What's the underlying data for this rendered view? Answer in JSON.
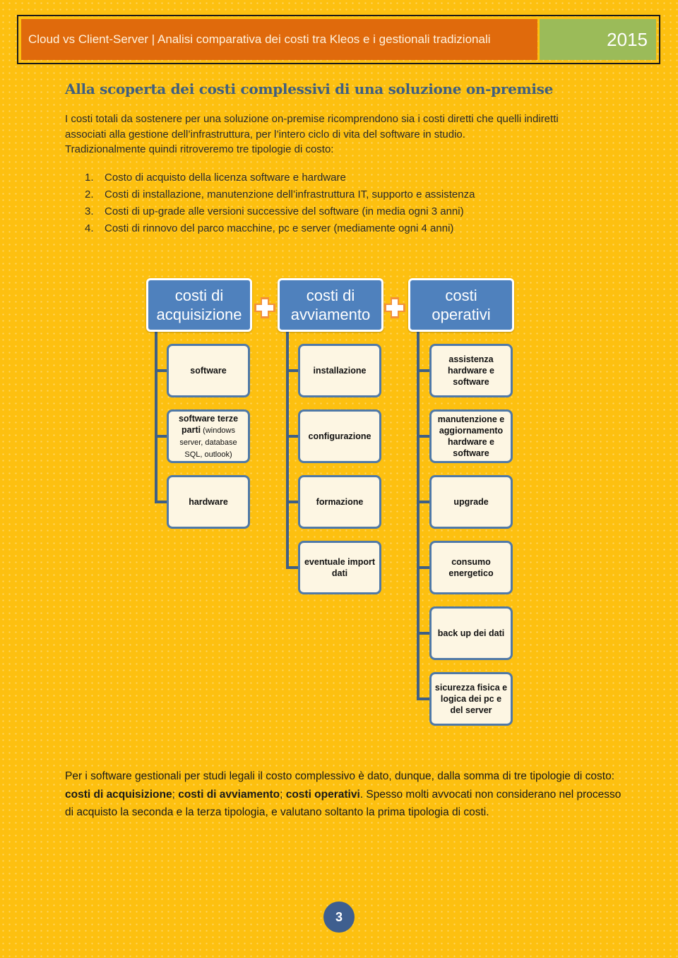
{
  "header": {
    "title": "Cloud vs Client-Server | Analisi comparativa dei costi tra Kleos e i gestionali tradizionali",
    "year": "2015",
    "colors": {
      "title_bg": "#E06A0C",
      "year_bg": "#9BBB59",
      "page_bg": "#FDC010"
    }
  },
  "section": {
    "title": "Alla scoperta dei costi complessivi di una soluzione on-premise",
    "intro": [
      "I costi totali da sostenere per una soluzione on-premise ricomprendono sia i costi diretti che quelli indiretti",
      "associati alla gestione dell’infrastruttura, per l’intero ciclo di vita del software in studio.",
      "Tradizionalmente quindi ritroveremo tre tipologie di costo:"
    ],
    "list": [
      {
        "num": "1.",
        "text": "Costo di acquisto della licenza software e hardware"
      },
      {
        "num": "2.",
        "text": "Costi di installazione, manutenzione dell’infrastruttura IT, supporto e assistenza"
      },
      {
        "num": "3.",
        "text": "Costi di up-grade alle versioni successive del software (in media ogni 3 anni)"
      },
      {
        "num": "4.",
        "text": "Costi di rinnovo del parco macchine, pc e server (mediamente ogni 4 anni)"
      }
    ]
  },
  "diagram": {
    "operator_icon": "plus-icon",
    "categories": [
      {
        "line1": "costi di",
        "line2": "acquisizione",
        "items": [
          {
            "bold": "software",
            "normal": ""
          },
          {
            "bold": "software  terze parti",
            "normal": " (windows server, database SQL, outlook)"
          },
          {
            "bold": "hardware",
            "normal": ""
          }
        ]
      },
      {
        "line1": "costi di",
        "line2": "avviamento",
        "items": [
          {
            "bold": "installazione",
            "normal": ""
          },
          {
            "bold": "configurazione",
            "normal": ""
          },
          {
            "bold": "formazione",
            "normal": ""
          },
          {
            "bold": "eventuale import dati",
            "normal": ""
          }
        ]
      },
      {
        "line1": "costi",
        "line2": "operativi",
        "items": [
          {
            "bold": "assistenza hardware e software",
            "normal": ""
          },
          {
            "bold": "manutenzione e aggiornamento hardware e software",
            "normal": ""
          },
          {
            "bold": "upgrade",
            "normal": ""
          },
          {
            "bold": "consumo energetico",
            "normal": ""
          },
          {
            "bold": "back up dei dati",
            "normal": ""
          },
          {
            "bold": "sicurezza fisica e logica dei pc e del server",
            "normal": ""
          }
        ]
      }
    ]
  },
  "closing": {
    "t1": "Per i software gestionali per studi legali il costo complessivo è dato, dunque, dalla somma di tre tipologie di costo: ",
    "b1": "costi di acquisizione",
    "t2": "; ",
    "b2": "costi di avviamento",
    "t3": "; ",
    "b3": "costi operativi",
    "t4": ". Spesso molti avvocati non considerano nel processo di acquisto la seconda e la terza tipologia, e valutano soltanto la prima tipologia di costi."
  },
  "page_number": "3"
}
